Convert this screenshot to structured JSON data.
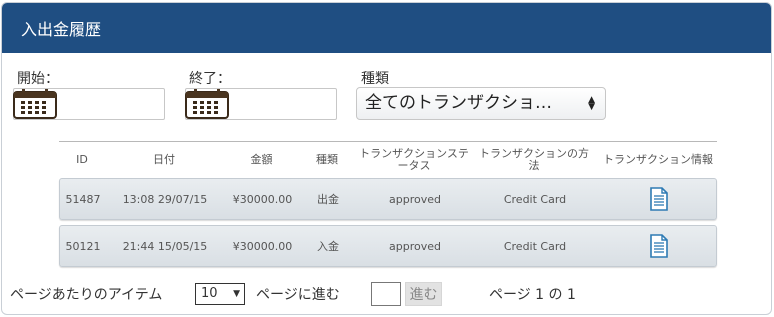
{
  "header": {
    "title": "入出金履歴"
  },
  "filters": {
    "start_label": "開始：",
    "end_label": "終了：",
    "type_label": "種類",
    "type_value": "全てのトランザクショ…"
  },
  "table": {
    "columns": [
      "ID",
      "日付",
      "金額",
      "種類",
      "トランザクションステータス",
      "トランザクションの方法",
      "トランザクション情報"
    ],
    "rows": [
      {
        "id": "51487",
        "date": "13:08 29/07/15",
        "amount": "¥30000.00",
        "type": "出金",
        "status": "approved",
        "method": "Credit Card",
        "info_icon": "document-icon"
      },
      {
        "id": "50121",
        "date": "21:44 15/05/15",
        "amount": "¥30000.00",
        "type": "入金",
        "status": "approved",
        "method": "Credit Card",
        "info_icon": "document-icon"
      }
    ]
  },
  "pager": {
    "items_per_page_label": "ページあたりのアイテム",
    "items_per_page_value": "10",
    "goto_label": "ページに進む",
    "goto_value": "",
    "goto_button": "進む",
    "page_info": "ページ 1 の 1"
  },
  "colors": {
    "header_bg": "#1f4e82",
    "icon_blue": "#2e7bb4"
  }
}
